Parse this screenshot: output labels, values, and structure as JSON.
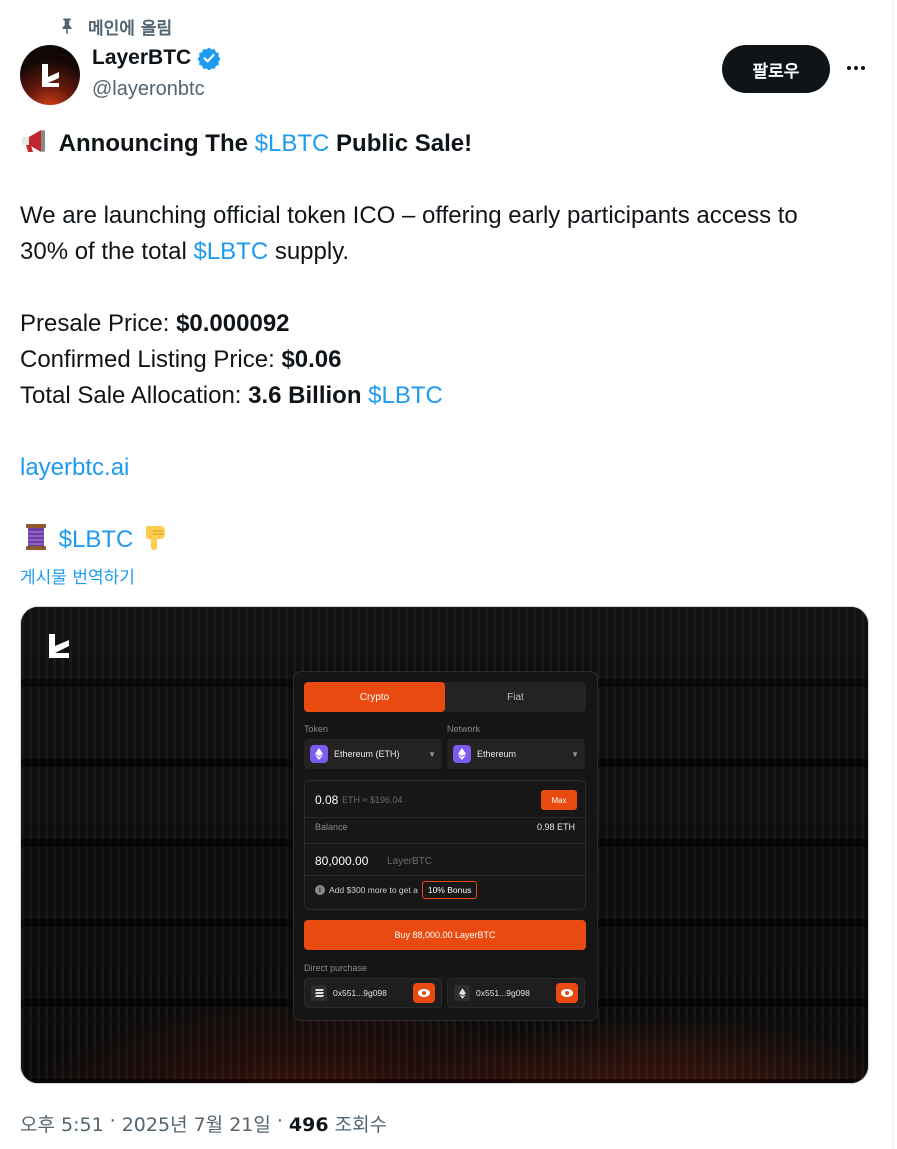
{
  "pinned": {
    "label": "메인에 올림"
  },
  "author": {
    "name": "LayerBTC",
    "handle": "@layeronbtc"
  },
  "follow_label": "팔로우",
  "post": {
    "headline_prefix": "Announcing The ",
    "headline_ticker": "$LBTC",
    "headline_suffix": " Public Sale!",
    "para1_line1": "We are launching official token ICO – offering early participants access to",
    "para1_line2_prefix": "30% of the total ",
    "para1_ticker": "$LBTC",
    "para1_line2_suffix": " supply.",
    "presale_label": "Presale Price: ",
    "presale_value": "$0.000092",
    "listing_label": "Confirmed Listing Price: ",
    "listing_value": "$0.06",
    "allocation_label": "Total Sale Allocation: ",
    "allocation_value": "3.6 Billion",
    "allocation_ticker": "$LBTC",
    "website_link": "layerbtc.ai",
    "thread_ticker": "$LBTC"
  },
  "translate_label": "게시물 번역하기",
  "widget": {
    "tabs": [
      "Crypto",
      "Fiat"
    ],
    "token_label": "Token",
    "token_value": "Ethereum (ETH)",
    "network_label": "Network",
    "network_value": "Ethereum",
    "amount_value": "0.08",
    "amount_unit": "ETH ≈ $196.04",
    "max_label": "Max",
    "balance_label": "Balance",
    "balance_value": "0.98 ETH",
    "receive_value": "80,000.00",
    "receive_unit": "LayerBTC",
    "bonus_text": "Add $300 more to get a",
    "bonus_badge": "10% Bonus",
    "buy_label": "Buy 88,000.00 LayerBTC",
    "direct_label": "Direct purchase",
    "address_1": "0x551...9g098",
    "address_2": "0x551...9g098"
  },
  "meta": {
    "time": "오후 5:51",
    "sep1": "·",
    "date": "2025년 7월 21일",
    "sep2": "·",
    "views_count": "496",
    "views_label": "조회수"
  },
  "colors": {
    "link": "#1d9bf0",
    "accent_orange": "#ea4a10",
    "verified": "#1d9bf0"
  },
  "icons": [
    "pin-icon",
    "verified-badge-icon",
    "more-icon",
    "megaphone-icon",
    "thread-spool-icon",
    "pointing-down-icon",
    "layerbtc-logo-icon",
    "eth-icon",
    "info-icon",
    "eye-icon"
  ]
}
